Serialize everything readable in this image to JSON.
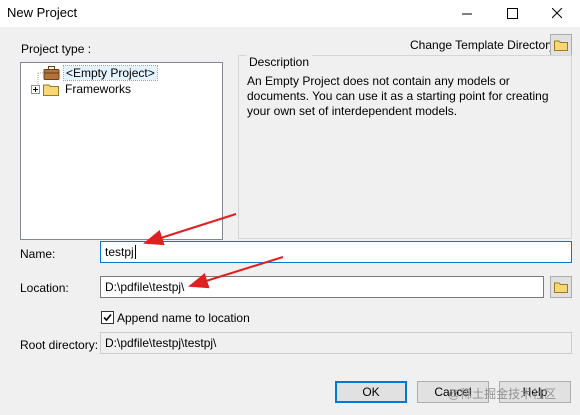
{
  "window": {
    "title": "New Project"
  },
  "labels": {
    "project_type": "Project type :",
    "change_template": "Change Template Directory:",
    "description": "Description",
    "name": "Name:",
    "location": "Location:",
    "append": "Append name to location",
    "root_directory": "Root directory:"
  },
  "tree": {
    "items": [
      {
        "label": "<Empty Project>",
        "icon": "briefcase-icon",
        "selected": true
      },
      {
        "label": "Frameworks",
        "icon": "folder-icon",
        "expandable": true
      }
    ]
  },
  "description_text": "An Empty Project does not contain any models or documents. You can use it as a starting point for creating your own set of interdependent models.",
  "fields": {
    "name": "testpj",
    "location": "D:\\pdfile\\testpj\\",
    "root_directory": "D:\\pdfile\\testpj\\testpj\\",
    "append_checked": true
  },
  "buttons": {
    "ok": "OK",
    "cancel": "Cancel",
    "help": "Help"
  },
  "watermark": "@稀土掘金技术社区",
  "colors": {
    "annotation_arrow": "#e02020",
    "focus_border": "#0078d7"
  }
}
